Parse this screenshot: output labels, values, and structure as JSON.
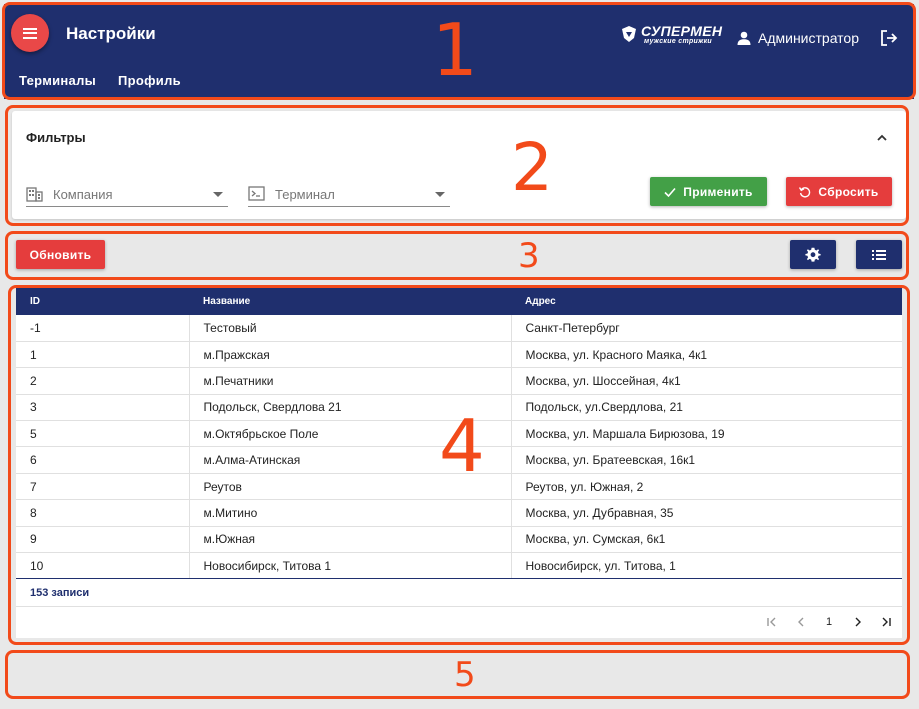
{
  "header": {
    "title": "Настройки",
    "menu_icon": "hamburger-menu-icon",
    "tabs": [
      {
        "label": "Терминалы"
      },
      {
        "label": "Профиль"
      }
    ],
    "logo": {
      "main": "СУПЕРМЕН",
      "sub": "мужские стрижки"
    },
    "user_name": "Администратор",
    "colors": {
      "bar": "#1f2f6e",
      "menu_button": "#e94848"
    }
  },
  "filters": {
    "title": "Фильтры",
    "company_label": "Компания",
    "terminal_label": "Терминал",
    "apply_label": "Применить",
    "reset_label": "Сбросить",
    "colors": {
      "apply": "#43a047",
      "reset": "#e53d3d"
    }
  },
  "toolbar": {
    "refresh_label": "Обновить",
    "settings_icon": "gear-icon",
    "columns_icon": "list-icon"
  },
  "table": {
    "columns": [
      "ID",
      "Название",
      "Адрес"
    ],
    "rows": [
      [
        "-1",
        "Тестовый",
        "Санкт-Петербург"
      ],
      [
        "1",
        "м.Пражская",
        "Москва, ул. Красного Маяка, 4к1"
      ],
      [
        "2",
        "м.Печатники",
        "Москва, ул. Шоссейная, 4к1"
      ],
      [
        "3",
        "Подольск, Свердлова 21",
        "Подольск, ул.Свердлова, 21"
      ],
      [
        "5",
        "м.Октябрьское Поле",
        "Москва, ул. Маршала Бирюзова, 19"
      ],
      [
        "6",
        "м.Алма-Атинская",
        "Москва, ул. Братеевская, 16к1"
      ],
      [
        "7",
        "Реутов",
        "Реутов, ул. Южная, 2"
      ],
      [
        "8",
        "м.Митино",
        "Москва, ул. Дубравная, 35"
      ],
      [
        "9",
        "м.Южная",
        "Москва, ул. Сумская, 6к1"
      ],
      [
        "10",
        "Новосибирск, Титова 1",
        "Новосибирск, ул. Титова, 1"
      ]
    ],
    "records_text": "153 записи",
    "page": "1"
  },
  "annotations": [
    "1",
    "2",
    "3",
    "4",
    "5"
  ],
  "annotation_color": "#f24a1a"
}
